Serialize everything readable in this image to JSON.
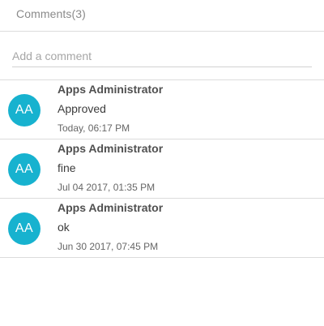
{
  "header": {
    "title": "Comments(3)"
  },
  "composer": {
    "placeholder": "Add a comment"
  },
  "comments": [
    {
      "avatar_initials": "AA",
      "author": "Apps Administrator",
      "text": "Approved",
      "time": "Today, 06:17 PM"
    },
    {
      "avatar_initials": "AA",
      "author": "Apps Administrator",
      "text": "fine",
      "time": "Jul 04 2017, 01:35 PM"
    },
    {
      "avatar_initials": "AA",
      "author": "Apps Administrator",
      "text": "ok",
      "time": "Jun 30 2017, 07:45 PM"
    }
  ],
  "colors": {
    "avatar_bg": "#17b2cf",
    "divider": "#dcdcdc"
  }
}
